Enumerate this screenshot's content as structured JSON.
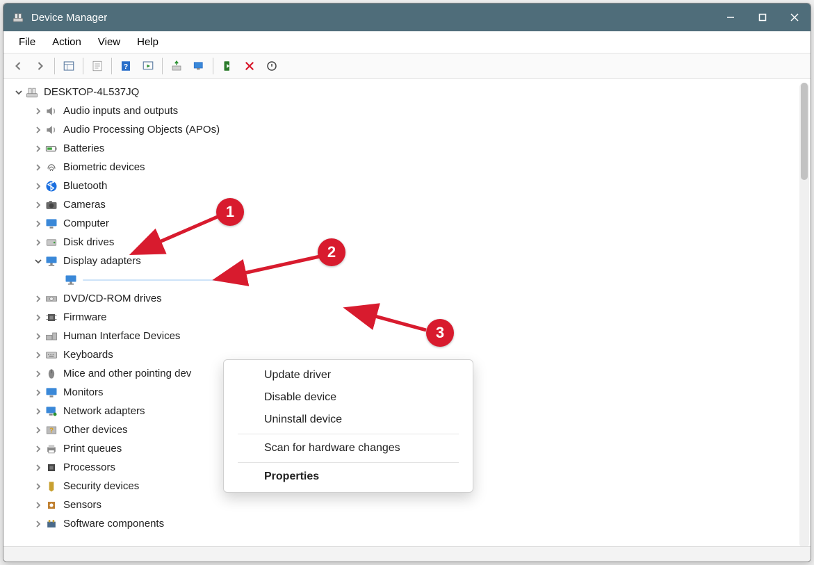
{
  "window": {
    "title": "Device Manager"
  },
  "menu": {
    "file": "File",
    "action": "Action",
    "view": "View",
    "help": "Help"
  },
  "tree": {
    "root": "DESKTOP-4L537JQ",
    "items": [
      {
        "label": "Audio inputs and outputs",
        "icon": "speaker"
      },
      {
        "label": "Audio Processing Objects (APOs)",
        "icon": "speaker"
      },
      {
        "label": "Batteries",
        "icon": "battery"
      },
      {
        "label": "Biometric devices",
        "icon": "fingerprint"
      },
      {
        "label": "Bluetooth",
        "icon": "bluetooth"
      },
      {
        "label": "Cameras",
        "icon": "camera"
      },
      {
        "label": "Computer",
        "icon": "monitor"
      },
      {
        "label": "Disk drives",
        "icon": "disk"
      },
      {
        "label": "Display adapters",
        "icon": "monitor-stand",
        "expanded": true,
        "children": [
          {
            "label": " ",
            "icon": "monitor-stand",
            "selected": true
          }
        ]
      },
      {
        "label": "DVD/CD-ROM drives",
        "icon": "optical"
      },
      {
        "label": "Firmware",
        "icon": "chip"
      },
      {
        "label": "Human Interface Devices",
        "icon": "hid"
      },
      {
        "label": "Keyboards",
        "icon": "keyboard"
      },
      {
        "label": "Mice and other pointing dev",
        "icon": "mouse"
      },
      {
        "label": "Monitors",
        "icon": "monitor"
      },
      {
        "label": "Network adapters",
        "icon": "network"
      },
      {
        "label": "Other devices",
        "icon": "question"
      },
      {
        "label": "Print queues",
        "icon": "printer"
      },
      {
        "label": "Processors",
        "icon": "cpu"
      },
      {
        "label": "Security devices",
        "icon": "shield"
      },
      {
        "label": "Sensors",
        "icon": "sensor"
      },
      {
        "label": "Software components",
        "icon": "component"
      }
    ]
  },
  "context_menu": {
    "update": "Update driver",
    "disable": "Disable device",
    "uninstall": "Uninstall device",
    "scan": "Scan for hardware changes",
    "properties": "Properties"
  },
  "annotations": {
    "one": "1",
    "two": "2",
    "three": "3"
  }
}
